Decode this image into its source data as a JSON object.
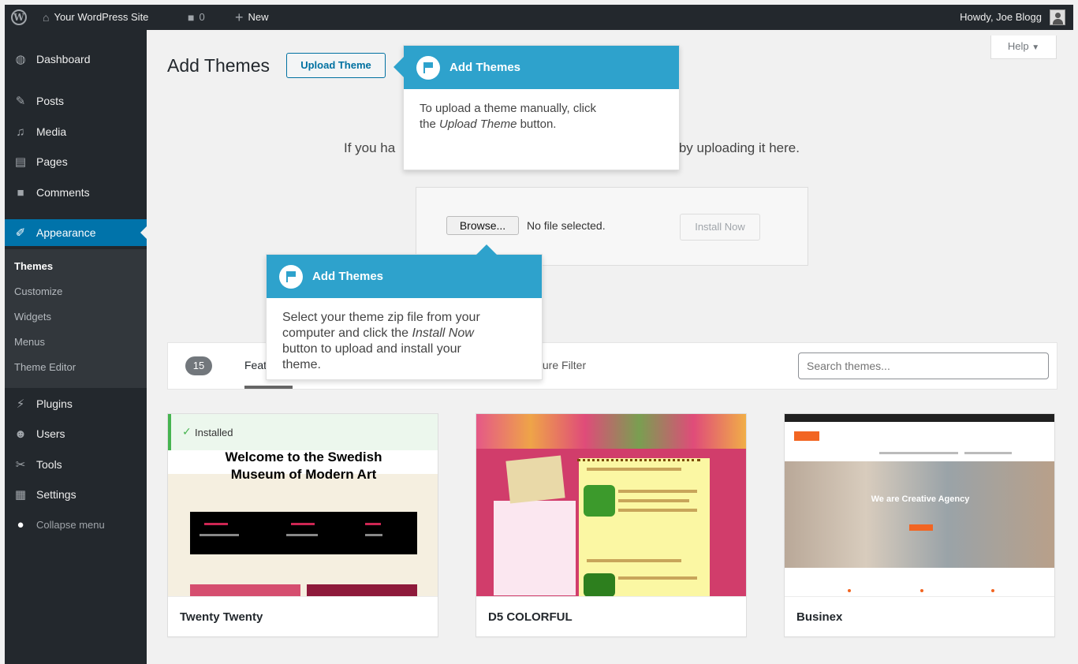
{
  "adminbar": {
    "site_name": "Your WordPress Site",
    "comments_count": "0",
    "new_label": "New",
    "howdy": "Howdy, Joe Blogg"
  },
  "sidebar": {
    "items": [
      {
        "label": "Dashboard",
        "icon": "dashboard-icon"
      },
      {
        "label": "Posts",
        "icon": "pin-icon"
      },
      {
        "label": "Media",
        "icon": "media-icon"
      },
      {
        "label": "Pages",
        "icon": "page-icon"
      },
      {
        "label": "Comments",
        "icon": "comment-icon"
      },
      {
        "label": "Appearance",
        "icon": "brush-icon"
      },
      {
        "label": "Plugins",
        "icon": "plug-icon"
      },
      {
        "label": "Users",
        "icon": "users-icon"
      },
      {
        "label": "Tools",
        "icon": "wrench-icon"
      },
      {
        "label": "Settings",
        "icon": "settings-icon"
      },
      {
        "label": "Collapse menu",
        "icon": "collapse-icon"
      }
    ],
    "submenu": [
      "Themes",
      "Customize",
      "Widgets",
      "Menus",
      "Theme Editor"
    ]
  },
  "main": {
    "title": "Add Themes",
    "upload_button": "Upload Theme",
    "help": "Help",
    "description_start": "If you ha",
    "description_end": "nstall it by uploading it here.",
    "browse_button": "Browse...",
    "file_status": "No file selected.",
    "install_button": "Install Now"
  },
  "filter": {
    "count": "15",
    "tab_featured": "Feat",
    "tab_feature_filter": "ture Filter",
    "search_placeholder": "Search themes..."
  },
  "themes": [
    {
      "name": "Twenty Twenty",
      "installed_label": "Installed",
      "preview_title_line1": "Welcome to the Swedish",
      "preview_title_line2": "Museum of Modern Art"
    },
    {
      "name": "D5 COLORFUL"
    },
    {
      "name": "Businex",
      "hero_text": "We are Creative Agency"
    }
  ],
  "tooltips": {
    "top": {
      "title": "Add Themes",
      "body_line1": "To upload a theme manually, click",
      "body_prefix": "the ",
      "body_em": "Upload Theme",
      "body_suffix": " button."
    },
    "bottom": {
      "title": "Add Themes",
      "body_line1": "Select your theme zip file from your",
      "body_line2_prefix": "computer and click the ",
      "body_em": "Install Now",
      "body_line3": "button to upload and install your",
      "body_line4": "theme."
    }
  },
  "colors": {
    "admin_dark": "#23282d",
    "accent_blue": "#0073aa",
    "pointer_blue": "#2ea2cc",
    "installed_green": "#46b450"
  }
}
